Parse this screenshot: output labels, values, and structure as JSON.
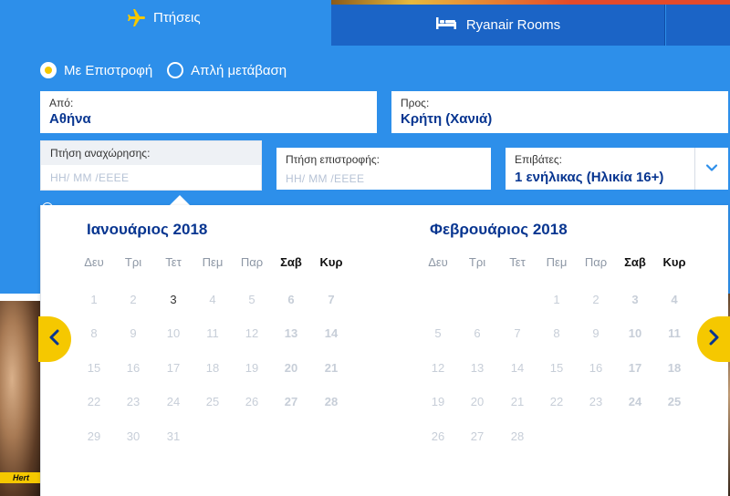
{
  "tabs": {
    "flights_label": "Πτήσεις",
    "rooms_label": "Ryanair Rooms"
  },
  "trip_type": {
    "return_label": "Με Επιστροφή",
    "oneway_label": "Απλή μετάβαση",
    "selected": "return"
  },
  "from": {
    "label": "Από:",
    "value": "Αθήνα"
  },
  "to": {
    "label": "Προς:",
    "value": "Κρήτη (Χανιά)"
  },
  "departure": {
    "label": "Πτήση αναχώρησης:",
    "placeholder": "ΗΗ/ ΜΜ /ΕΕΕΕ"
  },
  "return": {
    "label": "Πτήση επιστροφής:",
    "placeholder": "ΗΗ/ ΜΜ /ΕΕΕΕ"
  },
  "passengers": {
    "label": "Επιβάτες:",
    "value": "1 ενήλικας (Ηλικία 16+)"
  },
  "photo_badge": "Hert",
  "calendar": {
    "weekdays": [
      "Δευ",
      "Τρι",
      "Τετ",
      "Πεμ",
      "Παρ",
      "Σαβ",
      "Κυρ"
    ],
    "months": [
      {
        "title": "Ιανουάριος 2018",
        "weeks": [
          [
            "1",
            "2",
            "3",
            "4",
            "5",
            "6",
            "7"
          ],
          [
            "8",
            "9",
            "10",
            "11",
            "12",
            "13",
            "14"
          ],
          [
            "15",
            "16",
            "17",
            "18",
            "19",
            "20",
            "21"
          ],
          [
            "22",
            "23",
            "24",
            "25",
            "26",
            "27",
            "28"
          ],
          [
            "29",
            "30",
            "31",
            "",
            "",
            "",
            ""
          ]
        ],
        "today": "3"
      },
      {
        "title": "Φεβρουάριος 2018",
        "weeks": [
          [
            "",
            "",
            "",
            "1",
            "2",
            "3",
            "4"
          ],
          [
            "5",
            "6",
            "7",
            "8",
            "9",
            "10",
            "11"
          ],
          [
            "12",
            "13",
            "14",
            "15",
            "16",
            "17",
            "18"
          ],
          [
            "19",
            "20",
            "21",
            "22",
            "23",
            "24",
            "25"
          ],
          [
            "26",
            "27",
            "28",
            "",
            "",
            "",
            ""
          ]
        ],
        "today": ""
      }
    ]
  },
  "colors": {
    "brand_blue": "#2d8fea",
    "dark_blue": "#073590",
    "accent_yellow": "#f5c800"
  }
}
